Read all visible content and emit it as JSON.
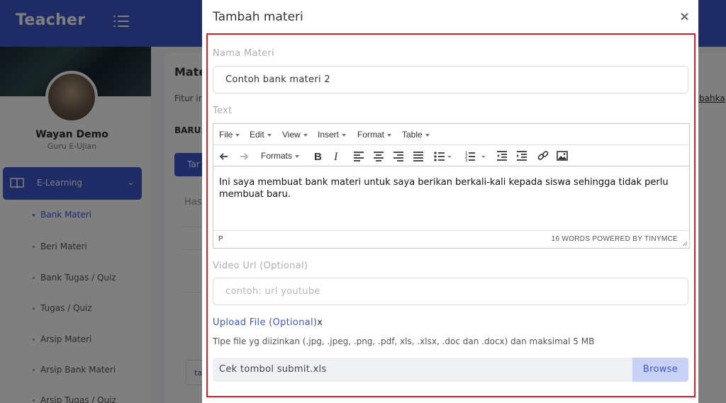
{
  "app": {
    "brand": "Teacher"
  },
  "user": {
    "name": "Wayan Demo",
    "role": "Guru E-Ujian"
  },
  "sidebar": {
    "active_section": "E-Learning",
    "items": [
      {
        "label": "Bank Materi",
        "active": true
      },
      {
        "label": "Beri Materi",
        "active": false
      },
      {
        "label": "Bank Tugas / Quiz",
        "active": false
      },
      {
        "label": "Tugas / Quiz",
        "active": false
      },
      {
        "label": "Arsip Materi",
        "active": false
      },
      {
        "label": "Arsip Bank Materi",
        "active": false
      },
      {
        "label": "Arsip Tugas / Quiz",
        "active": false
      }
    ]
  },
  "content": {
    "title": "Mate",
    "fitur": "Fitur ir",
    "baru": "BARU:",
    "button": "Tar",
    "hasil": "Has",
    "ta_button": "ta",
    "link": "bahka"
  },
  "modal": {
    "title": "Tambah materi",
    "close": "×",
    "nama_label": "Nama Materi",
    "nama_value": "Contoh bank materi 2",
    "text_label": "Text",
    "editor": {
      "menus": [
        "File",
        "Edit",
        "View",
        "Insert",
        "Format",
        "Table"
      ],
      "formats_label": "Formats",
      "content": "Ini saya membuat bank materi untuk saya berikan berkali-kali kepada siswa sehingga tidak perlu membuat baru.",
      "path": "P",
      "word_count": "16 WORDS POWERED BY TINYMCE"
    },
    "video_label": "Video Url (Optional)",
    "video_placeholder": "contoh: url youtube",
    "upload_label": "Upload File (Optional)",
    "upload_x": "x",
    "tipe_text": "Tipe file yg diizinkan (.jpg, .jpeg, .png, .pdf, xls, .xlsx, .doc dan .docx) dan maksimal 5 MB",
    "file_name": "Cek tombol submit.xls",
    "browse_label": "Browse"
  },
  "colors": {
    "primary": "#3f57c9",
    "highlight": "#e21b23",
    "overlay": "rgba(0,0,0,0.5)"
  }
}
